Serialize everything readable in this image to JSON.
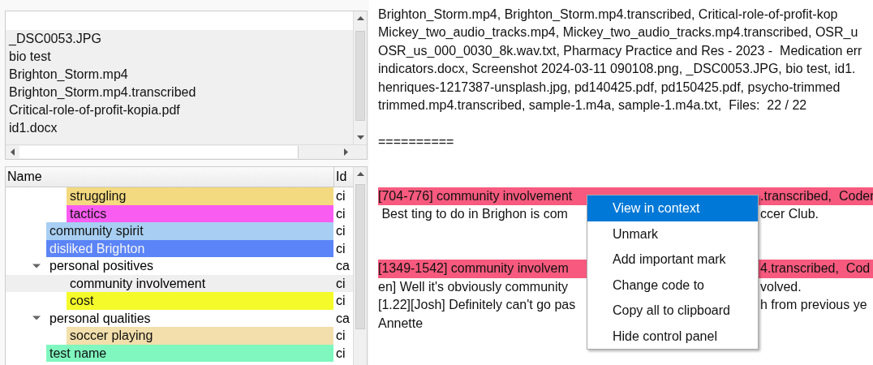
{
  "file_list": {
    "items": [
      "_DSC0053.JPG",
      "bio test",
      "Brighton_Storm.mp4",
      "Brighton_Storm.mp4.transcribed",
      "Critical-role-of-profit-kopia.pdf",
      "id1.docx"
    ]
  },
  "code_tree": {
    "columns": [
      "Name",
      "Id"
    ],
    "rows": [
      {
        "kind": "continuation",
        "children": [
          {
            "kind": "code",
            "name": "struggling",
            "column_2": "ci",
            "color": "#f3d97f",
            "selected": false
          },
          {
            "kind": "code",
            "name": "tactics",
            "column_2": "ci",
            "color": "#f95cf0",
            "selected": false
          }
        ]
      },
      {
        "kind": "code",
        "name": "community spirit",
        "column_2": "ci",
        "color": "#a8cff3",
        "selected": false
      },
      {
        "kind": "code",
        "name": "disliked Brighton",
        "column_2": "ci",
        "color": "#5b84f8",
        "selected": false
      },
      {
        "kind": "category",
        "name": "personal positives",
        "column_2": "ca",
        "expanded": true,
        "selected": false,
        "children": [
          {
            "kind": "code",
            "name": "community involvement",
            "column_2": "ci",
            "selected": true
          },
          {
            "kind": "code",
            "name": "cost",
            "column_2": "ci",
            "color": "#f5fb2a",
            "selected": false
          }
        ]
      },
      {
        "kind": "category",
        "name": "personal qualities",
        "column_2": "ca",
        "expanded": true,
        "selected": false,
        "children": [
          {
            "kind": "code",
            "name": "soccer playing",
            "column_2": "ci",
            "color": "#f2dfab",
            "selected": false
          }
        ]
      },
      {
        "kind": "code",
        "name": "test name",
        "column_2": "ci",
        "color": "#7ff7bf",
        "selected": false
      }
    ]
  },
  "editor": {
    "lines": [
      {
        "kind": "text",
        "text": "Brighton_Storm.mp4, Brighton_Storm.mp4.transcribed, Critical-role-of-profit-kop"
      },
      {
        "kind": "text",
        "text": "Mickey_two_audio_tracks.mp4, Mickey_two_audio_tracks.mp4.transcribed, OSR_u"
      },
      {
        "kind": "text",
        "text": "OSR_us_000_0030_8k.wav.txt, Pharmacy Practice and Res - 2023 -  Medication err"
      },
      {
        "kind": "text",
        "text": "indicators.docx, Screenshot 2024-03-11 090108.png, _DSC0053.JPG, bio test, id1."
      },
      {
        "kind": "text",
        "text": "henriques-1217387-unsplash.jpg, pd140425.pdf, pd150425.pdf, psycho-trimmed"
      },
      {
        "kind": "text",
        "text": "trimmed.mp4.transcribed, sample-1.m4a, sample-1.m4a.txt,  Files:  22 / 22"
      },
      {
        "kind": "blank"
      },
      {
        "kind": "text",
        "text": "=========="
      },
      {
        "kind": "blank"
      },
      {
        "kind": "blank"
      },
      {
        "kind": "split",
        "left": "[704-776] community involvement",
        "right": ".transcribed,  Coder",
        "highlight": true
      },
      {
        "kind": "split",
        "left": " Best ting to do in Brighon is com",
        "right": "ccer Club.",
        "highlight": false
      },
      {
        "kind": "blank"
      },
      {
        "kind": "blank"
      },
      {
        "kind": "split",
        "left": "[1349-1542] community involvem",
        "right": "4.transcribed,  Cod",
        "highlight": true
      },
      {
        "kind": "split",
        "left": "en] Well it's obviously community",
        "right": "volved.",
        "highlight": false
      },
      {
        "kind": "split",
        "left": "[1.22][Josh] Definitely can't go pas",
        "right": "h from previous ye",
        "highlight": false
      },
      {
        "kind": "text",
        "text": "Annette"
      }
    ]
  },
  "context_menu": {
    "items": [
      {
        "label": "View in context",
        "selected": true
      },
      {
        "label": "Unmark",
        "selected": false
      },
      {
        "label": "Add important mark",
        "selected": false
      },
      {
        "label": "Change code to",
        "selected": false
      },
      {
        "label": "Copy all to clipboard",
        "selected": false
      },
      {
        "label": "Hide control panel",
        "selected": false
      }
    ]
  }
}
